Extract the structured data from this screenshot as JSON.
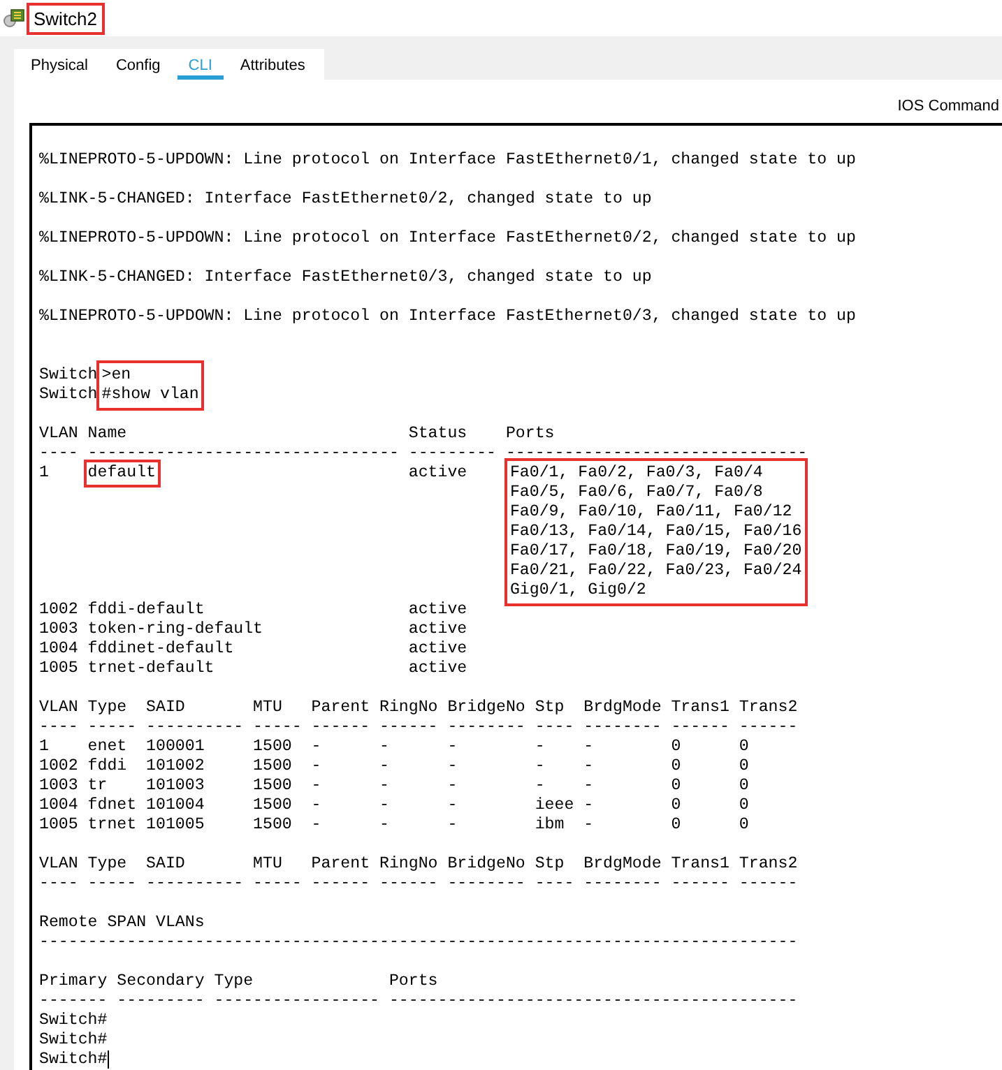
{
  "window": {
    "title": "Switch2",
    "title_highlighted": true
  },
  "tabs": [
    {
      "label": "Physical",
      "selected": false
    },
    {
      "label": "Config",
      "selected": false
    },
    {
      "label": "CLI",
      "selected": true
    },
    {
      "label": "Attributes",
      "selected": false
    }
  ],
  "panel_heading": "IOS Command",
  "terminal": {
    "lines": [
      {
        "kind": "blank"
      },
      {
        "kind": "text",
        "segments": [
          {
            "text": "%LINEPROTO-5-UPDOWN: Line protocol on Interface FastEthernet0/1, changed state to up"
          }
        ]
      },
      {
        "kind": "blank"
      },
      {
        "kind": "text",
        "segments": [
          {
            "text": "%LINK-5-CHANGED: Interface FastEthernet0/2, changed state to up"
          }
        ]
      },
      {
        "kind": "blank"
      },
      {
        "kind": "text",
        "segments": [
          {
            "text": "%LINEPROTO-5-UPDOWN: Line protocol on Interface FastEthernet0/2, changed state to up"
          }
        ]
      },
      {
        "kind": "blank"
      },
      {
        "kind": "text",
        "segments": [
          {
            "text": "%LINK-5-CHANGED: Interface FastEthernet0/3, changed state to up"
          }
        ]
      },
      {
        "kind": "blank"
      },
      {
        "kind": "text",
        "segments": [
          {
            "text": "%LINEPROTO-5-UPDOWN: Line protocol on Interface FastEthernet0/3, changed state to up"
          }
        ]
      },
      {
        "kind": "blank"
      },
      {
        "kind": "blank"
      },
      {
        "kind": "text",
        "segments": [
          {
            "lines": [
              "Switch",
              "Switch"
            ],
            "highlighted": false
          },
          {
            "lines": [
              ">en",
              "#show vlan"
            ],
            "highlighted": true
          }
        ]
      },
      {
        "kind": "blank"
      },
      {
        "kind": "text",
        "segments": [
          {
            "text": "VLAN Name                             Status    Ports"
          }
        ]
      },
      {
        "kind": "text",
        "segments": [
          {
            "text": "---- -------------------------------- --------- -------------------------------"
          }
        ]
      },
      {
        "kind": "text",
        "segments": [
          {
            "text": "1    ",
            "highlighted": false
          },
          {
            "text": "default",
            "highlighted": true
          },
          {
            "text": "                          active    ",
            "highlighted": false
          },
          {
            "lines": [
              "Fa0/1, Fa0/2, Fa0/3, Fa0/4",
              "Fa0/5, Fa0/6, Fa0/7, Fa0/8",
              "Fa0/9, Fa0/10, Fa0/11, Fa0/12",
              "Fa0/13, Fa0/14, Fa0/15, Fa0/16",
              "Fa0/17, Fa0/18, Fa0/19, Fa0/20",
              "Fa0/21, Fa0/22, Fa0/23, Fa0/24",
              "Gig0/1, Gig0/2"
            ],
            "highlighted": true
          }
        ]
      },
      {
        "kind": "text",
        "segments": [
          {
            "text": "1002 fddi-default                     active"
          }
        ]
      },
      {
        "kind": "text",
        "segments": [
          {
            "text": "1003 token-ring-default               active"
          }
        ]
      },
      {
        "kind": "text",
        "segments": [
          {
            "text": "1004 fddinet-default                  active"
          }
        ]
      },
      {
        "kind": "text",
        "segments": [
          {
            "text": "1005 trnet-default                    active"
          }
        ]
      },
      {
        "kind": "blank"
      },
      {
        "kind": "text",
        "segments": [
          {
            "text": "VLAN Type  SAID       MTU   Parent RingNo BridgeNo Stp  BrdgMode Trans1 Trans2"
          }
        ]
      },
      {
        "kind": "text",
        "segments": [
          {
            "text": "---- ----- ---------- ----- ------ ------ -------- ---- -------- ------ ------"
          }
        ]
      },
      {
        "kind": "text",
        "segments": [
          {
            "text": "1    enet  100001     1500  -      -      -        -    -        0      0"
          }
        ]
      },
      {
        "kind": "text",
        "segments": [
          {
            "text": "1002 fddi  101002     1500  -      -      -        -    -        0      0"
          }
        ]
      },
      {
        "kind": "text",
        "segments": [
          {
            "text": "1003 tr    101003     1500  -      -      -        -    -        0      0"
          }
        ]
      },
      {
        "kind": "text",
        "segments": [
          {
            "text": "1004 fdnet 101004     1500  -      -      -        ieee -        0      0"
          }
        ]
      },
      {
        "kind": "text",
        "segments": [
          {
            "text": "1005 trnet 101005     1500  -      -      -        ibm  -        0      0"
          }
        ]
      },
      {
        "kind": "blank"
      },
      {
        "kind": "text",
        "segments": [
          {
            "text": "VLAN Type  SAID       MTU   Parent RingNo BridgeNo Stp  BrdgMode Trans1 Trans2"
          }
        ]
      },
      {
        "kind": "text",
        "segments": [
          {
            "text": "---- ----- ---------- ----- ------ ------ -------- ---- -------- ------ ------"
          }
        ]
      },
      {
        "kind": "blank"
      },
      {
        "kind": "text",
        "segments": [
          {
            "text": "Remote SPAN VLANs"
          }
        ]
      },
      {
        "kind": "text",
        "segments": [
          {
            "text": "------------------------------------------------------------------------------"
          }
        ]
      },
      {
        "kind": "blank"
      },
      {
        "kind": "text",
        "segments": [
          {
            "text": "Primary Secondary Type              Ports"
          }
        ]
      },
      {
        "kind": "text",
        "segments": [
          {
            "text": "------- --------- ----------------- ------------------------------------------"
          }
        ]
      },
      {
        "kind": "text",
        "segments": [
          {
            "text": "Switch#"
          }
        ]
      },
      {
        "kind": "text",
        "segments": [
          {
            "text": "Switch#"
          }
        ]
      },
      {
        "kind": "text",
        "segments": [
          {
            "text": "Switch#"
          }
        ]
      }
    ],
    "cursor": true
  }
}
